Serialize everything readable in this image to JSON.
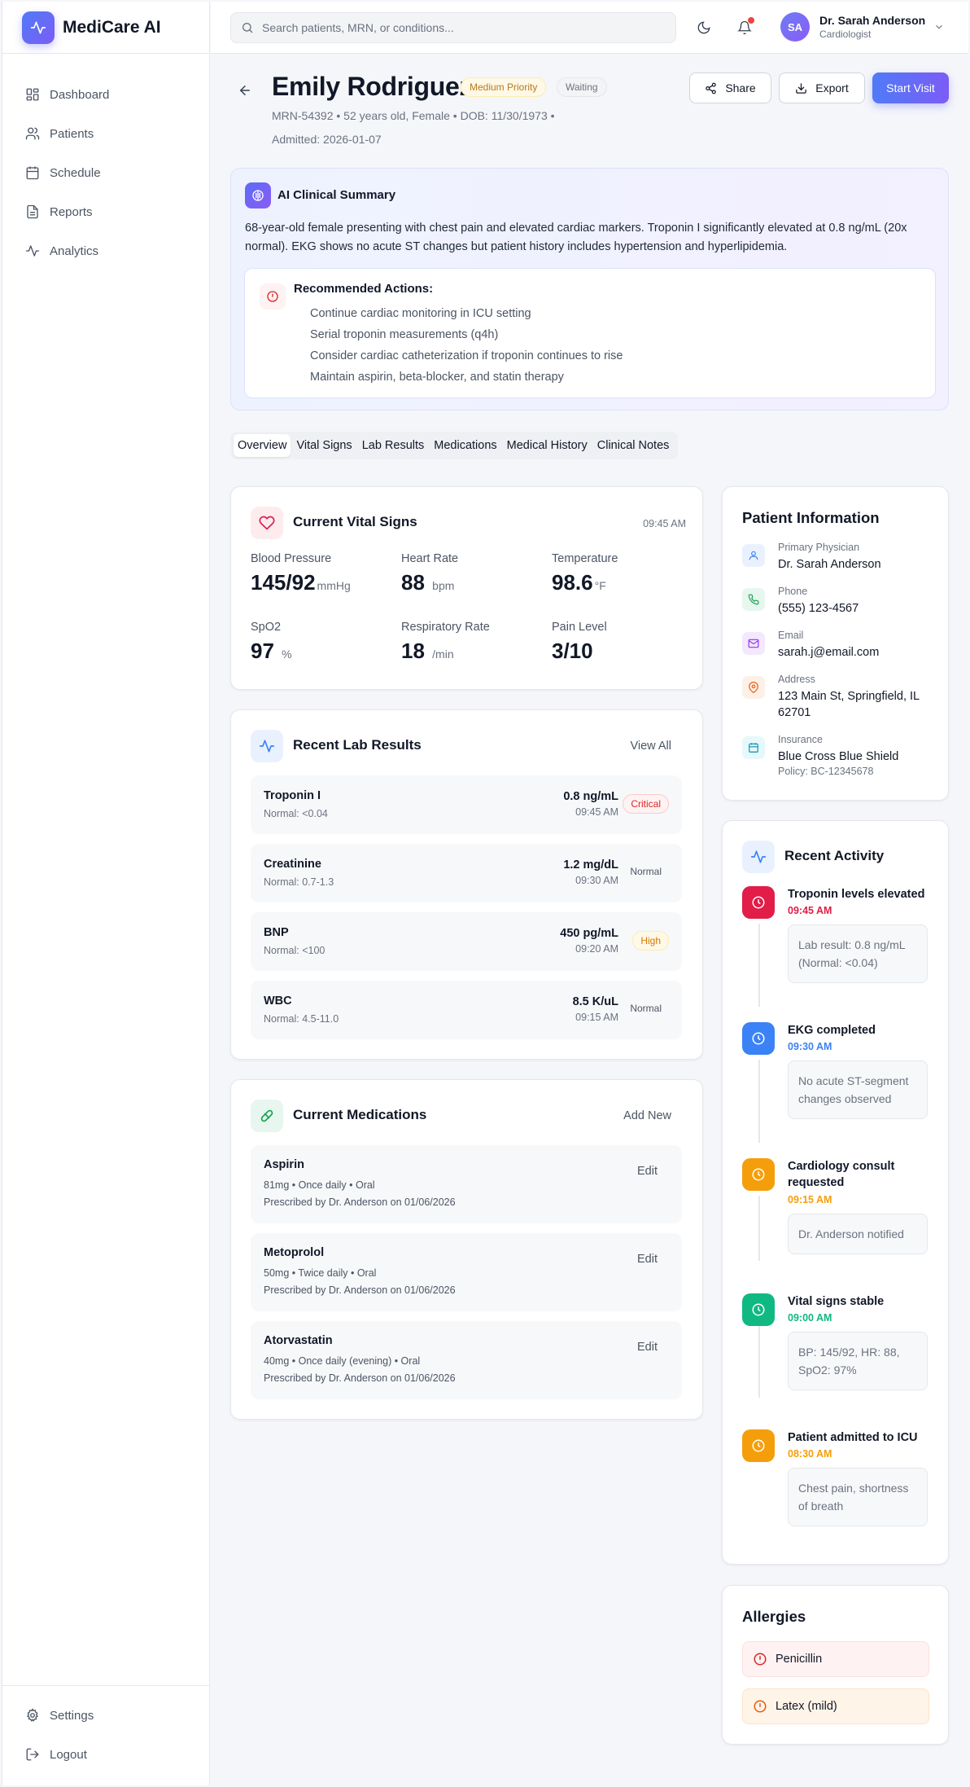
{
  "app": {
    "name": "MediCare AI"
  },
  "sidebar": {
    "items": [
      {
        "label": "Dashboard",
        "icon": "dashboard-icon"
      },
      {
        "label": "Patients",
        "icon": "users-icon"
      },
      {
        "label": "Schedule",
        "icon": "calendar-icon"
      },
      {
        "label": "Reports",
        "icon": "file-icon"
      },
      {
        "label": "Analytics",
        "icon": "activity-icon"
      }
    ],
    "bottom": [
      {
        "label": "Settings",
        "icon": "gear-icon"
      },
      {
        "label": "Logout",
        "icon": "logout-icon"
      }
    ]
  },
  "header": {
    "search_placeholder": "Search patients, MRN, or conditions...",
    "user": {
      "initials": "SA",
      "name": "Dr. Sarah Anderson",
      "role": "Cardiologist"
    }
  },
  "patient": {
    "name": "Emily Rodriguez",
    "priority": "Medium Priority",
    "status": "Waiting",
    "mrn": "MRN-54392",
    "age_sex": "52 years old, Female",
    "dob": "DOB: 11/30/1973",
    "admitted": "Admitted: 2026-01-07",
    "bullet": "•"
  },
  "actions": {
    "share": "Share",
    "export": "Export",
    "start": "Start Visit"
  },
  "ai_summary": {
    "title": "AI Clinical Summary",
    "text": "68-year-old female presenting with chest pain and elevated cardiac markers. Troponin I significantly elevated at 0.8 ng/mL (20x normal). EKG shows no acute ST changes but patient history includes hypertension and hyperlipidemia.",
    "recommended_title": "Recommended Actions:",
    "recommended": [
      "Continue cardiac monitoring in ICU setting",
      "Serial troponin measurements (q4h)",
      "Consider cardiac catheterization if troponin continues to rise",
      "Maintain aspirin, beta-blocker, and statin therapy"
    ]
  },
  "tabs": [
    "Overview",
    "Vital Signs",
    "Lab Results",
    "Medications",
    "Medical History",
    "Clinical Notes"
  ],
  "vitals": {
    "title": "Current Vital Signs",
    "time": "09:45 AM",
    "items": [
      {
        "label": "Blood Pressure",
        "value": "145/92",
        "unit": "mmHg"
      },
      {
        "label": "Heart Rate",
        "value": "88",
        "unit": "bpm"
      },
      {
        "label": "Temperature",
        "value": "98.6",
        "unit": "°F"
      },
      {
        "label": "SpO2",
        "value": "97",
        "unit": "%"
      },
      {
        "label": "Respiratory Rate",
        "value": "18",
        "unit": "/min"
      },
      {
        "label": "Pain Level",
        "value": "3/10",
        "unit": ""
      }
    ]
  },
  "labs": {
    "title": "Recent Lab Results",
    "view_all": "View All",
    "items": [
      {
        "name": "Troponin I",
        "normal": "Normal: <0.04",
        "value": "0.8 ng/mL",
        "time": "09:45 AM",
        "status": "Critical"
      },
      {
        "name": "Creatinine",
        "normal": "Normal: 0.7-1.3",
        "value": "1.2 mg/dL",
        "time": "09:30 AM",
        "status": "Normal"
      },
      {
        "name": "BNP",
        "normal": "Normal: <100",
        "value": "450 pg/mL",
        "time": "09:20 AM",
        "status": "High"
      },
      {
        "name": "WBC",
        "normal": "Normal: 4.5-11.0",
        "value": "8.5 K/uL",
        "time": "09:15 AM",
        "status": "Normal"
      }
    ]
  },
  "medications": {
    "title": "Current Medications",
    "add_new": "Add New",
    "edit": "Edit",
    "items": [
      {
        "name": "Aspirin",
        "dose": "81mg • Once daily • Oral",
        "prescribed": "Prescribed by Dr. Anderson on 01/06/2026"
      },
      {
        "name": "Metoprolol",
        "dose": "50mg • Twice daily • Oral",
        "prescribed": "Prescribed by Dr. Anderson on 01/06/2026"
      },
      {
        "name": "Atorvastatin",
        "dose": "40mg • Once daily (evening) • Oral",
        "prescribed": "Prescribed by Dr. Anderson on 01/06/2026"
      }
    ]
  },
  "patient_info": {
    "title": "Patient Information",
    "physician_label": "Primary Physician",
    "physician": "Dr. Sarah Anderson",
    "phone_label": "Phone",
    "phone": "(555) 123-4567",
    "email_label": "Email",
    "email": "sarah.j@email.com",
    "address_label": "Address",
    "address": "123 Main St, Springfield, IL 62701",
    "insurance_label": "Insurance",
    "insurance": "Blue Cross Blue Shield",
    "policy": "Policy: BC-12345678"
  },
  "activity": {
    "title": "Recent Activity",
    "items": [
      {
        "title": "Troponin levels elevated",
        "time": "09:45 AM",
        "detail": "Lab result: 0.8 ng/mL (Normal: <0.04)",
        "color": "#e11d48"
      },
      {
        "title": "EKG completed",
        "time": "09:30 AM",
        "detail": "No acute ST-segment changes observed",
        "color": "#3b82f6"
      },
      {
        "title": "Cardiology consult requested",
        "time": "09:15 AM",
        "detail": "Dr. Anderson notified",
        "color": "#f59e0b"
      },
      {
        "title": "Vital signs stable",
        "time": "09:00 AM",
        "detail": "BP: 145/92, HR: 88, SpO2: 97%",
        "color": "#10b981"
      },
      {
        "title": "Patient admitted to ICU",
        "time": "08:30 AM",
        "detail": "Chest pain, shortness of breath",
        "color": "#f59e0b"
      }
    ]
  },
  "allergies": {
    "title": "Allergies",
    "items": [
      {
        "name": "Penicillin",
        "color": "#dc2626"
      },
      {
        "name": "Latex (mild)",
        "color": "#ea580c"
      }
    ]
  }
}
